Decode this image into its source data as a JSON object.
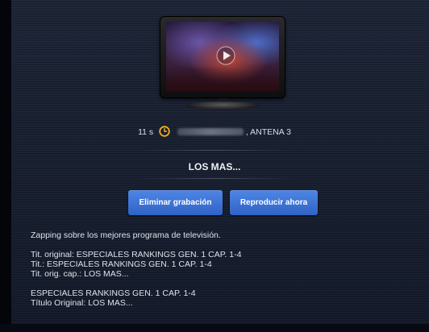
{
  "recording": {
    "duration": "11 s",
    "channel": ", ANTENA 3",
    "title": "LOS MAS..."
  },
  "actions": {
    "delete_label": "Eliminar grabación",
    "play_label": "Reproducir ahora"
  },
  "description": {
    "summary": "Zapping sobre los mejores programa de televisión.",
    "lines_a": [
      "Tit. original: ESPECIALES RANKINGS GEN. 1 CAP. 1-4",
      "Tit.: ESPECIALES RANKINGS GEN. 1 CAP. 1-4",
      "Tit. orig. cap.: LOS MAS..."
    ],
    "lines_b": [
      "ESPECIALES RANKINGS GEN. 1 CAP. 1-4",
      "Título Original: LOS MAS..."
    ]
  },
  "icons": {
    "clock": "clock-icon",
    "play": "play-icon",
    "tv": "tv-icon"
  },
  "colors": {
    "accent": "#3b70d6",
    "clock": "#f2b01e",
    "background": "#161d2d"
  }
}
